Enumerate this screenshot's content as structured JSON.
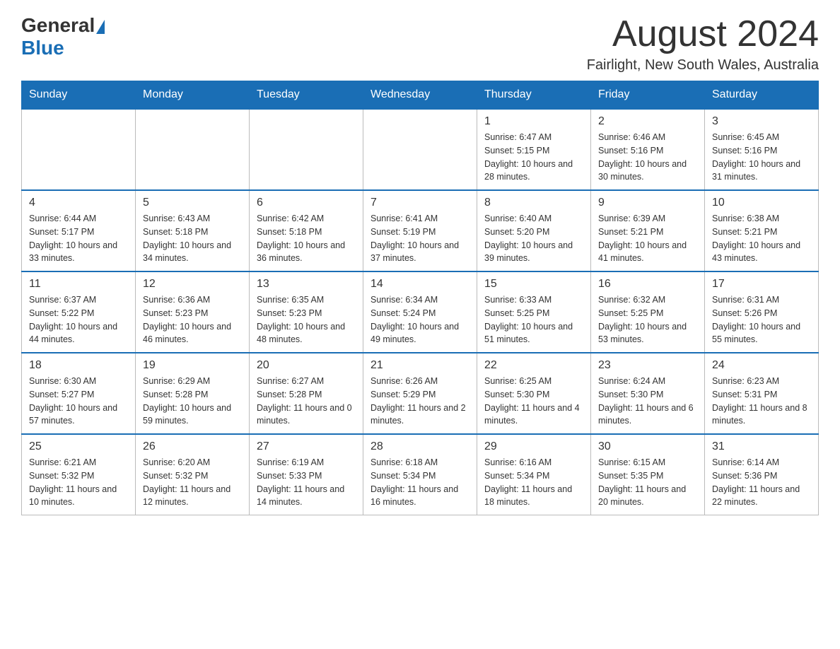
{
  "logo": {
    "general": "General",
    "blue": "Blue"
  },
  "title": "August 2024",
  "location": "Fairlight, New South Wales, Australia",
  "days_of_week": [
    "Sunday",
    "Monday",
    "Tuesday",
    "Wednesday",
    "Thursday",
    "Friday",
    "Saturday"
  ],
  "weeks": [
    [
      {
        "day": "",
        "info": ""
      },
      {
        "day": "",
        "info": ""
      },
      {
        "day": "",
        "info": ""
      },
      {
        "day": "",
        "info": ""
      },
      {
        "day": "1",
        "info": "Sunrise: 6:47 AM\nSunset: 5:15 PM\nDaylight: 10 hours and 28 minutes."
      },
      {
        "day": "2",
        "info": "Sunrise: 6:46 AM\nSunset: 5:16 PM\nDaylight: 10 hours and 30 minutes."
      },
      {
        "day": "3",
        "info": "Sunrise: 6:45 AM\nSunset: 5:16 PM\nDaylight: 10 hours and 31 minutes."
      }
    ],
    [
      {
        "day": "4",
        "info": "Sunrise: 6:44 AM\nSunset: 5:17 PM\nDaylight: 10 hours and 33 minutes."
      },
      {
        "day": "5",
        "info": "Sunrise: 6:43 AM\nSunset: 5:18 PM\nDaylight: 10 hours and 34 minutes."
      },
      {
        "day": "6",
        "info": "Sunrise: 6:42 AM\nSunset: 5:18 PM\nDaylight: 10 hours and 36 minutes."
      },
      {
        "day": "7",
        "info": "Sunrise: 6:41 AM\nSunset: 5:19 PM\nDaylight: 10 hours and 37 minutes."
      },
      {
        "day": "8",
        "info": "Sunrise: 6:40 AM\nSunset: 5:20 PM\nDaylight: 10 hours and 39 minutes."
      },
      {
        "day": "9",
        "info": "Sunrise: 6:39 AM\nSunset: 5:21 PM\nDaylight: 10 hours and 41 minutes."
      },
      {
        "day": "10",
        "info": "Sunrise: 6:38 AM\nSunset: 5:21 PM\nDaylight: 10 hours and 43 minutes."
      }
    ],
    [
      {
        "day": "11",
        "info": "Sunrise: 6:37 AM\nSunset: 5:22 PM\nDaylight: 10 hours and 44 minutes."
      },
      {
        "day": "12",
        "info": "Sunrise: 6:36 AM\nSunset: 5:23 PM\nDaylight: 10 hours and 46 minutes."
      },
      {
        "day": "13",
        "info": "Sunrise: 6:35 AM\nSunset: 5:23 PM\nDaylight: 10 hours and 48 minutes."
      },
      {
        "day": "14",
        "info": "Sunrise: 6:34 AM\nSunset: 5:24 PM\nDaylight: 10 hours and 49 minutes."
      },
      {
        "day": "15",
        "info": "Sunrise: 6:33 AM\nSunset: 5:25 PM\nDaylight: 10 hours and 51 minutes."
      },
      {
        "day": "16",
        "info": "Sunrise: 6:32 AM\nSunset: 5:25 PM\nDaylight: 10 hours and 53 minutes."
      },
      {
        "day": "17",
        "info": "Sunrise: 6:31 AM\nSunset: 5:26 PM\nDaylight: 10 hours and 55 minutes."
      }
    ],
    [
      {
        "day": "18",
        "info": "Sunrise: 6:30 AM\nSunset: 5:27 PM\nDaylight: 10 hours and 57 minutes."
      },
      {
        "day": "19",
        "info": "Sunrise: 6:29 AM\nSunset: 5:28 PM\nDaylight: 10 hours and 59 minutes."
      },
      {
        "day": "20",
        "info": "Sunrise: 6:27 AM\nSunset: 5:28 PM\nDaylight: 11 hours and 0 minutes."
      },
      {
        "day": "21",
        "info": "Sunrise: 6:26 AM\nSunset: 5:29 PM\nDaylight: 11 hours and 2 minutes."
      },
      {
        "day": "22",
        "info": "Sunrise: 6:25 AM\nSunset: 5:30 PM\nDaylight: 11 hours and 4 minutes."
      },
      {
        "day": "23",
        "info": "Sunrise: 6:24 AM\nSunset: 5:30 PM\nDaylight: 11 hours and 6 minutes."
      },
      {
        "day": "24",
        "info": "Sunrise: 6:23 AM\nSunset: 5:31 PM\nDaylight: 11 hours and 8 minutes."
      }
    ],
    [
      {
        "day": "25",
        "info": "Sunrise: 6:21 AM\nSunset: 5:32 PM\nDaylight: 11 hours and 10 minutes."
      },
      {
        "day": "26",
        "info": "Sunrise: 6:20 AM\nSunset: 5:32 PM\nDaylight: 11 hours and 12 minutes."
      },
      {
        "day": "27",
        "info": "Sunrise: 6:19 AM\nSunset: 5:33 PM\nDaylight: 11 hours and 14 minutes."
      },
      {
        "day": "28",
        "info": "Sunrise: 6:18 AM\nSunset: 5:34 PM\nDaylight: 11 hours and 16 minutes."
      },
      {
        "day": "29",
        "info": "Sunrise: 6:16 AM\nSunset: 5:34 PM\nDaylight: 11 hours and 18 minutes."
      },
      {
        "day": "30",
        "info": "Sunrise: 6:15 AM\nSunset: 5:35 PM\nDaylight: 11 hours and 20 minutes."
      },
      {
        "day": "31",
        "info": "Sunrise: 6:14 AM\nSunset: 5:36 PM\nDaylight: 11 hours and 22 minutes."
      }
    ]
  ]
}
